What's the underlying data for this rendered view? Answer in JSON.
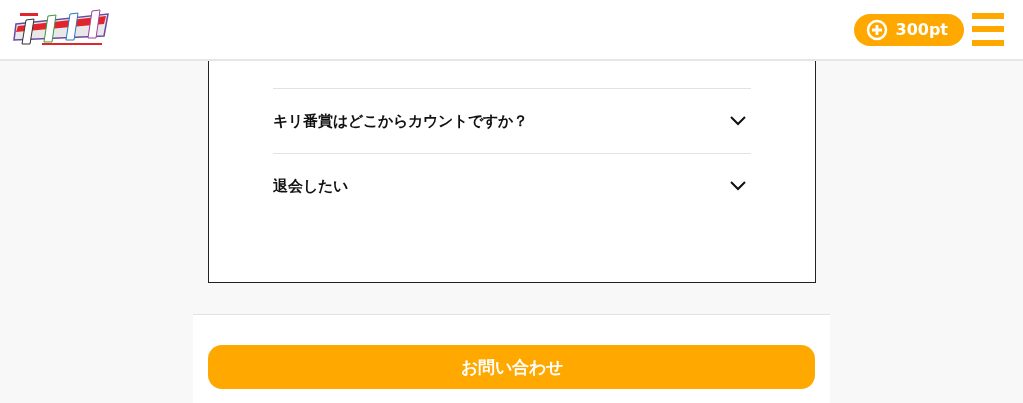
{
  "header": {
    "points": "300pt"
  },
  "faq": [
    {
      "question": "キリ番賞はどこからカウントですか？",
      "expanded": false
    },
    {
      "question": "退会したい",
      "expanded": false
    }
  ],
  "contact_button": "お問い合わせ"
}
